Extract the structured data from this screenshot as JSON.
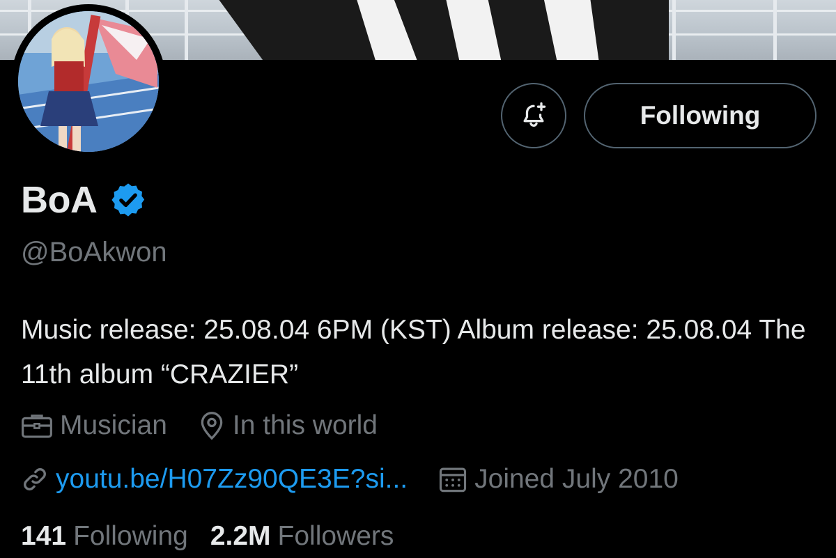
{
  "profile": {
    "display_name": "BoA",
    "verified": true,
    "handle": "@BoAkwon",
    "bio": "Music release: 25.08.04 6PM (KST) Album release: 25.08.04 The 11th album “CRAZIER”",
    "profession": "Musician",
    "location": "In this world",
    "website": "youtu.be/H07Zz90QE3E?si...",
    "joined": "Joined July 2010"
  },
  "actions": {
    "follow_label": "Following"
  },
  "stats": {
    "following_count": "141",
    "following_label": "Following",
    "followers_count": "2.2M",
    "followers_label": "Followers"
  },
  "icons": {
    "notifications": "bell-plus-icon",
    "profession": "briefcase-icon",
    "location": "location-pin-icon",
    "website": "link-icon",
    "joined": "calendar-icon",
    "verified": "verified-badge-icon"
  },
  "colors": {
    "background": "#000000",
    "primary_text": "#e7e9ea",
    "secondary_text": "#71767b",
    "link": "#1d9bf0",
    "border": "#536471",
    "verified": "#1d9bf0"
  }
}
